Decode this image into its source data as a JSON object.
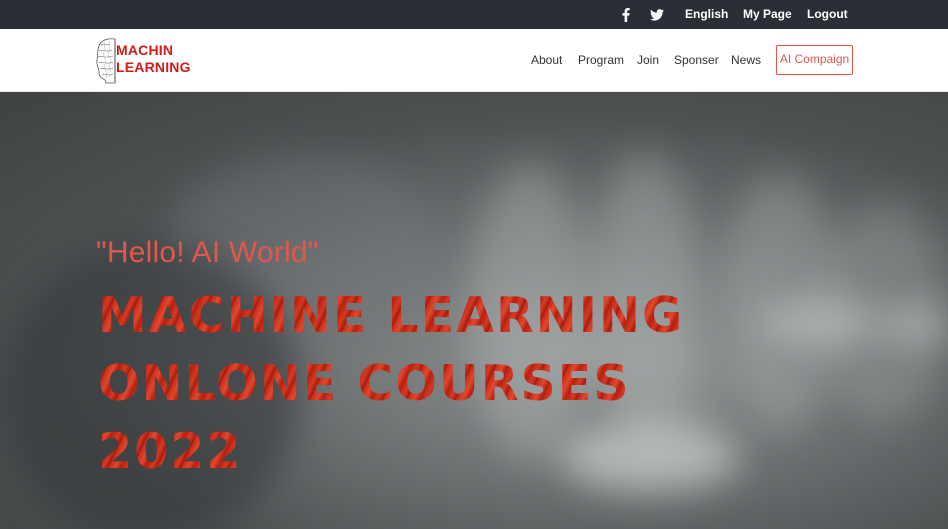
{
  "topbar": {
    "social": [
      {
        "icon": "facebook-icon",
        "glyph": "f"
      },
      {
        "icon": "twitter-icon"
      }
    ],
    "language": "English",
    "my_page": "My Page",
    "logout": "Logout"
  },
  "header": {
    "logo": {
      "line1": "MACHIN",
      "line2": "LEARNING",
      "color": "#d11a1a"
    },
    "nav": [
      {
        "label": "About"
      },
      {
        "label": "Program"
      },
      {
        "label": "Join"
      },
      {
        "label": "Sponser"
      },
      {
        "label": "News"
      }
    ],
    "cta": {
      "label": "AI Compaign",
      "color": "#e2574c"
    }
  },
  "hero": {
    "tagline": "\"Hello! AI World\"",
    "headline": "MACHINE LEARNING\nONLONE COURSES\n2022",
    "accent": "#e2574c"
  }
}
